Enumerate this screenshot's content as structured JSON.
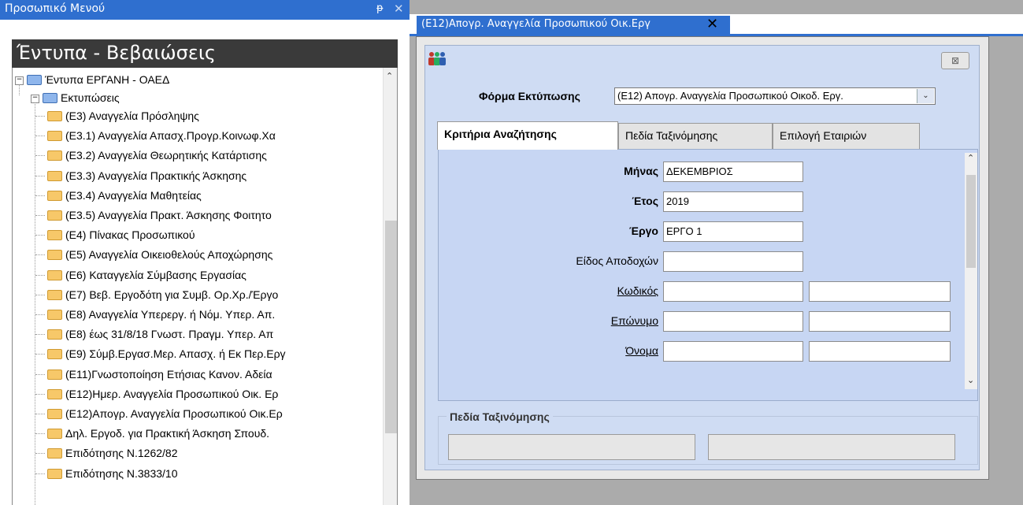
{
  "left_panel": {
    "title": "Προσωπικό Μενού",
    "pin_glyph": "ᵽ",
    "close_glyph": "✕",
    "section_title": "Έντυπα - Βεβαιώσεις",
    "tree": {
      "root_label": "Έντυπα ΕΡΓΑΝΗ - ΟΑΕΔ",
      "sub_label": "Εκτυπώσεις",
      "items": [
        "(Ε3) Αναγγελία Πρόσληψης",
        "(Ε3.1) Αναγγελία Απασχ.Προγρ.Κοινωφ.Χα",
        "(Ε3.2) Αναγγελία Θεωρητικής Κατάρτισης",
        "(Ε3.3) Αναγγελία Πρακτικής Άσκησης",
        "(Ε3.4) Αναγγελία Μαθητείας",
        "(Ε3.5) Αναγγελία Πρακτ. Άσκησης Φοιτητο",
        "(Ε4) Πίνακας Προσωπικού",
        "(Ε5) Αναγγελία Οικειοθελούς Αποχώρησης",
        "(Ε6) Καταγγελία Σύμβασης Εργασίας",
        "(Ε7) Βεβ. Εργοδότη για Συμβ. Ορ.Χρ./Έργο",
        "(Ε8) Αναγγελία Υπερεργ. ή Νόμ. Υπερ. Απ.",
        "(Ε8) έως 31/8/18 Γνωστ. Πραγμ. Υπερ. Απ",
        "(Ε9) Σύμβ.Εργασ.Μερ. Απασχ. ή Εκ Περ.Εργ",
        "(Ε11)Γνωστοποίηση Ετήσιας Κανον. Αδεία",
        "(Ε12)Ημερ. Αναγγελία Προσωπικού Οικ. Ερ",
        "(Ε12)Απογρ. Αναγγελία Προσωπικού Οικ.Ερ",
        "Δηλ. Εργοδ. για Πρακτική Άσκηση Σπουδ.",
        "Επιδότησης Ν.1262/82",
        "Επιδότησης Ν.3833/10"
      ]
    }
  },
  "doc_tab": {
    "label": "(Ε12)Απογρ. Αναγγελία Προσωπικού Οικ.Εργ",
    "close_glyph": "✕"
  },
  "form": {
    "close_glyph": "⊠",
    "print_form_label": "Φόρμα Εκτύπωσης",
    "print_form_value": "(Ε12) Απογρ. Αναγγελία Προσωπικού Οικοδ. Εργ.",
    "tabs": [
      "Κριτήρια Αναζήτησης",
      "Πεδία Ταξινόμησης",
      "Επιλογή Εταιριών"
    ],
    "criteria": {
      "month_label": "Μήνας",
      "month_value": "ΔΕΚΕΜΒΡΙΟΣ",
      "year_label": "Έτος",
      "year_value": "2019",
      "project_label": "Έργο",
      "project_value": "ΕΡΓΟ 1",
      "earnings_type_label": "Είδος Αποδοχών",
      "earnings_type_value": "",
      "code_label": "Κωδικός",
      "code_from": "",
      "code_to": "",
      "surname_label": "Επώνυμο",
      "surname_from": "",
      "surname_to": "",
      "name_label": "Όνομα",
      "name_from": "",
      "name_to": ""
    },
    "sort_group_label": "Πεδία Ταξινόμησης"
  }
}
